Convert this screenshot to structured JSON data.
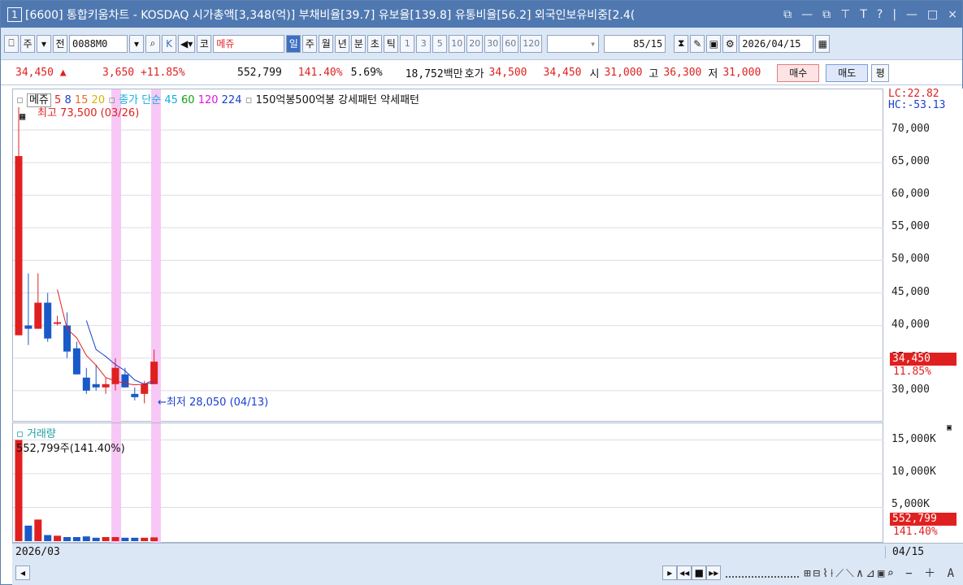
{
  "title": {
    "num": "1",
    "text": "[6600] 통합키움차트 - KOSDAQ 시가총액[3,348(억)] 부채비율[39.7] 유보율[139.8] 유통비율[56.2] 외국인보유비중[2.4(",
    "buttons": [
      "⧉",
      "—",
      "⧉",
      "⊤",
      "T",
      "?",
      "|",
      "—",
      "□",
      "×"
    ]
  },
  "toolbar": {
    "b1": "⎕",
    "b2": "주",
    "b3": "▾",
    "b4": "전",
    "code": "0088M0",
    "search": "⌕",
    "k": "K",
    "snd": "◀▾",
    "market": "코",
    "name": "메쥬",
    "periods": [
      "일",
      "주",
      "월",
      "년",
      "분",
      "초",
      "틱"
    ],
    "nums": [
      "1",
      "3",
      "5",
      "10",
      "20",
      "30",
      "60",
      "120"
    ],
    "count": "85",
    "total": "/15",
    "date": "2026/04/15"
  },
  "quote": {
    "price": "34,450 ▲",
    "change": "3,650 +11.85%",
    "volume": "552,799",
    "volpct": "141.40%",
    "turn": "5.69%",
    "amount": "18,752백만",
    "hoga_lbl": "호가",
    "hoga1": "34,500",
    "hoga2": "34,450",
    "open_lbl": "시",
    "open": "31,000",
    "high_lbl": "고",
    "high": "36,300",
    "low_lbl": "저",
    "low": "31,000",
    "buy": "매수",
    "sell": "매도",
    "pyung": "평"
  },
  "legend": {
    "name": "메쥬",
    "ma": [
      "5",
      "8",
      "15",
      "20"
    ],
    "ma_colors": [
      "#e02020",
      "#1a3fd0",
      "#e07020",
      "#e0b000"
    ],
    "close_lbl": "종가 단순",
    "ma2": [
      "45",
      "60",
      "120",
      "224"
    ],
    "ma2_colors": [
      "#10b0e0",
      "#10a010",
      "#e010e0",
      "#1a3fd0"
    ],
    "extra": "150억봉500억봉 강세패턴 약세패턴"
  },
  "annot": {
    "hi": "최고 73,500 (03/26)",
    "lo": "최저 28,050 (04/13)"
  },
  "axis": {
    "lc": "LC:22.82",
    "hc": "HC:-53.13",
    "prices": [
      "70,000",
      "65,000",
      "60,000",
      "55,000",
      "50,000",
      "45,000",
      "40,000",
      "35,000",
      "30,000"
    ],
    "cur": "34,450",
    "curpct": "11.85%",
    "vols": [
      "15,000K",
      "10,000K",
      "5,000K"
    ],
    "vcur": "552,799",
    "vcurpct": "141.40%"
  },
  "vol": {
    "title": "거래량",
    "val": "552,799주(141.40%)"
  },
  "dates": {
    "left": "2026/03",
    "right": "04/15"
  },
  "chart_data": {
    "type": "candlestick",
    "candles": [
      {
        "o": 38500,
        "h": 73500,
        "l": 38500,
        "c": 66000
      },
      {
        "o": 40000,
        "h": 48000,
        "l": 37000,
        "c": 39500
      },
      {
        "o": 39500,
        "h": 48000,
        "l": 39500,
        "c": 43500
      },
      {
        "o": 43500,
        "h": 45000,
        "l": 37500,
        "c": 38000
      },
      {
        "o": 40500,
        "h": 41500,
        "l": 40000,
        "c": 40500
      },
      {
        "o": 40000,
        "h": 42000,
        "l": 35000,
        "c": 36000
      },
      {
        "o": 36500,
        "h": 37500,
        "l": 32500,
        "c": 32500
      },
      {
        "o": 32000,
        "h": 33500,
        "l": 29500,
        "c": 30000
      },
      {
        "o": 31000,
        "h": 34000,
        "l": 30000,
        "c": 30500
      },
      {
        "o": 30500,
        "h": 32000,
        "l": 29500,
        "c": 31000
      },
      {
        "o": 31000,
        "h": 35000,
        "l": 30000,
        "c": 33500
      },
      {
        "o": 32500,
        "h": 33500,
        "l": 30500,
        "c": 30500
      },
      {
        "o": 29500,
        "h": 30500,
        "l": 28500,
        "c": 29000
      },
      {
        "o": 29500,
        "h": 31500,
        "l": 28050,
        "c": 31000
      },
      {
        "o": 31000,
        "h": 36300,
        "l": 31000,
        "c": 34450
      }
    ],
    "volumes": [
      15000,
      2300,
      3200,
      900,
      800,
      600,
      600,
      700,
      500,
      600,
      600,
      500,
      500,
      500,
      553
    ]
  }
}
